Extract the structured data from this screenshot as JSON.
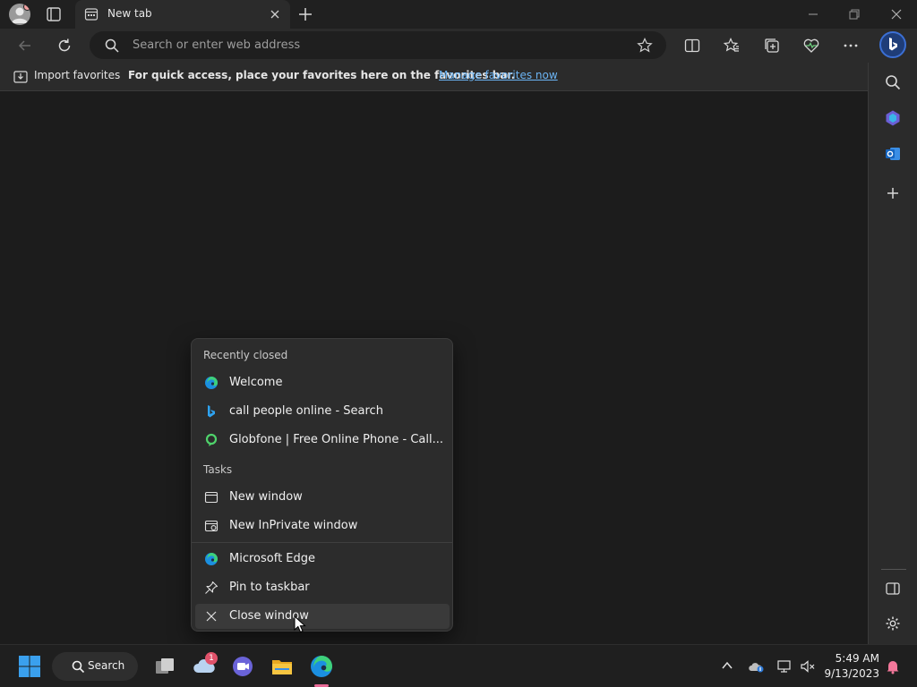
{
  "browser": {
    "tab_title": "New tab",
    "address_placeholder": "Search or enter web address"
  },
  "favorites_bar": {
    "import_label": "Import favorites",
    "tip": "For quick access, place your favorites here on the favorites bar.",
    "manage_link": "Manage favorites now"
  },
  "jumplist": {
    "recent_header": "Recently closed",
    "recent_items": [
      {
        "label": "Welcome",
        "icon": "edge-icon"
      },
      {
        "label": "call people online - Search",
        "icon": "bing-icon"
      },
      {
        "label": "Globfone | Free Online Phone - Call...",
        "icon": "globfone-icon"
      }
    ],
    "tasks_header": "Tasks",
    "task_items": [
      {
        "label": "New window",
        "icon": "window-icon"
      },
      {
        "label": "New InPrivate window",
        "icon": "inprivate-icon"
      }
    ],
    "app_items": [
      {
        "label": "Microsoft Edge",
        "icon": "edge-icon"
      },
      {
        "label": "Pin to taskbar",
        "icon": "pin-icon"
      },
      {
        "label": "Close window",
        "icon": "close-icon"
      }
    ]
  },
  "taskbar": {
    "search_label": "Search",
    "weather_badge": "1",
    "time": "5:49 AM",
    "date": "9/13/2023"
  },
  "colors": {
    "accent_link": "#6cb5f5",
    "edge_indicator": "#e86a96"
  }
}
